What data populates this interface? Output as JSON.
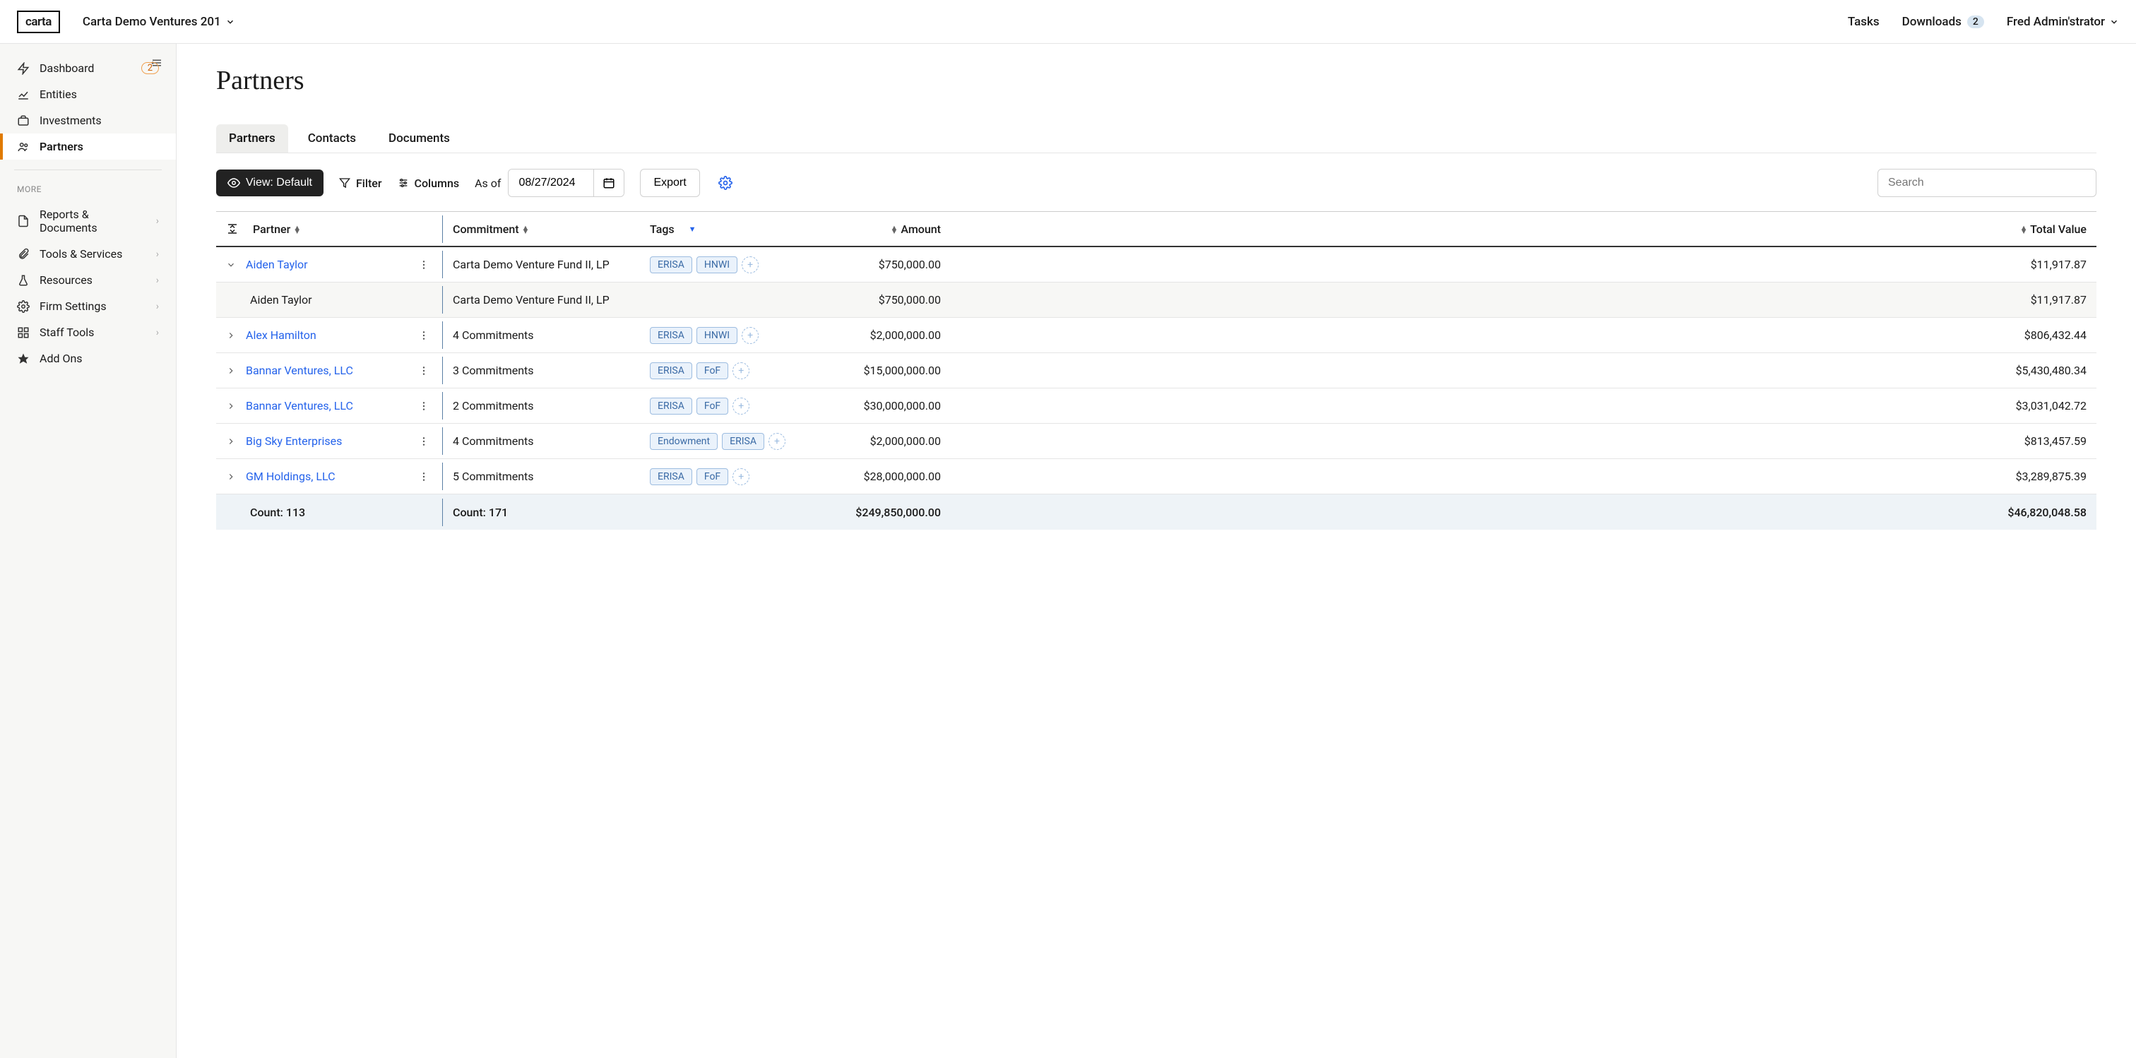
{
  "header": {
    "logo": "carta",
    "org": "Carta Demo Ventures 201",
    "tasks": "Tasks",
    "downloads": "Downloads",
    "downloads_badge": "2",
    "user": "Fred Admin'strator"
  },
  "sidebar": {
    "items": [
      {
        "label": "Dashboard",
        "badge": "2"
      },
      {
        "label": "Entities"
      },
      {
        "label": "Investments"
      },
      {
        "label": "Partners",
        "active": true
      }
    ],
    "more_label": "MORE",
    "more": [
      {
        "label": "Reports & Documents",
        "chev": true
      },
      {
        "label": "Tools & Services",
        "chev": true
      },
      {
        "label": "Resources",
        "chev": true
      },
      {
        "label": "Firm Settings",
        "chev": true
      },
      {
        "label": "Staff Tools",
        "chev": true
      },
      {
        "label": "Add Ons"
      }
    ]
  },
  "page": {
    "title": "Partners"
  },
  "tabs": [
    {
      "label": "Partners",
      "active": true
    },
    {
      "label": "Contacts"
    },
    {
      "label": "Documents"
    }
  ],
  "toolbar": {
    "view": "View: Default",
    "filter": "Filter",
    "columns": "Columns",
    "asof": "As of",
    "date": "08/27/2024",
    "export": "Export",
    "search_placeholder": "Search"
  },
  "table": {
    "headers": {
      "partner": "Partner",
      "commitment": "Commitment",
      "tags": "Tags",
      "amount": "Amount",
      "total": "Total Value"
    },
    "rows": [
      {
        "expanded": true,
        "name": "Aiden Taylor",
        "link": true,
        "commitment": "Carta Demo Venture Fund II, LP",
        "tags": [
          "ERISA",
          "HNWI"
        ],
        "tag_add": true,
        "amount": "$750,000.00",
        "total": "$11,917.87",
        "sub": {
          "name": "Aiden Taylor",
          "commitment": "Carta Demo Venture Fund II, LP",
          "amount": "$750,000.00",
          "total": "$11,917.87"
        }
      },
      {
        "name": "Alex Hamilton",
        "link": true,
        "commitment": "4 Commitments",
        "tags": [
          "ERISA",
          "HNWI"
        ],
        "tag_add": true,
        "amount": "$2,000,000.00",
        "total": "$806,432.44"
      },
      {
        "name": "Bannar Ventures, LLC",
        "link": true,
        "commitment": "3 Commitments",
        "tags": [
          "ERISA",
          "FoF"
        ],
        "tag_add": true,
        "amount": "$15,000,000.00",
        "total": "$5,430,480.34"
      },
      {
        "name": "Bannar Ventures, LLC",
        "link": true,
        "commitment": "2 Commitments",
        "tags": [
          "ERISA",
          "FoF"
        ],
        "tag_add": true,
        "amount": "$30,000,000.00",
        "total": "$3,031,042.72"
      },
      {
        "name": "Big Sky Enterprises",
        "link": true,
        "commitment": "4 Commitments",
        "tags": [
          "Endowment",
          "ERISA"
        ],
        "tag_add": true,
        "amount": "$2,000,000.00",
        "total": "$813,457.59"
      },
      {
        "name": "GM Holdings, LLC",
        "link": true,
        "commitment": "5 Commitments",
        "tags": [
          "ERISA",
          "FoF"
        ],
        "tag_add": true,
        "amount": "$28,000,000.00",
        "total": "$3,289,875.39"
      }
    ],
    "footer": {
      "partner_count": "Count: 113",
      "commit_count": "Count: 171",
      "amount_sum": "$249,850,000.00",
      "total_sum": "$46,820,048.58"
    }
  }
}
